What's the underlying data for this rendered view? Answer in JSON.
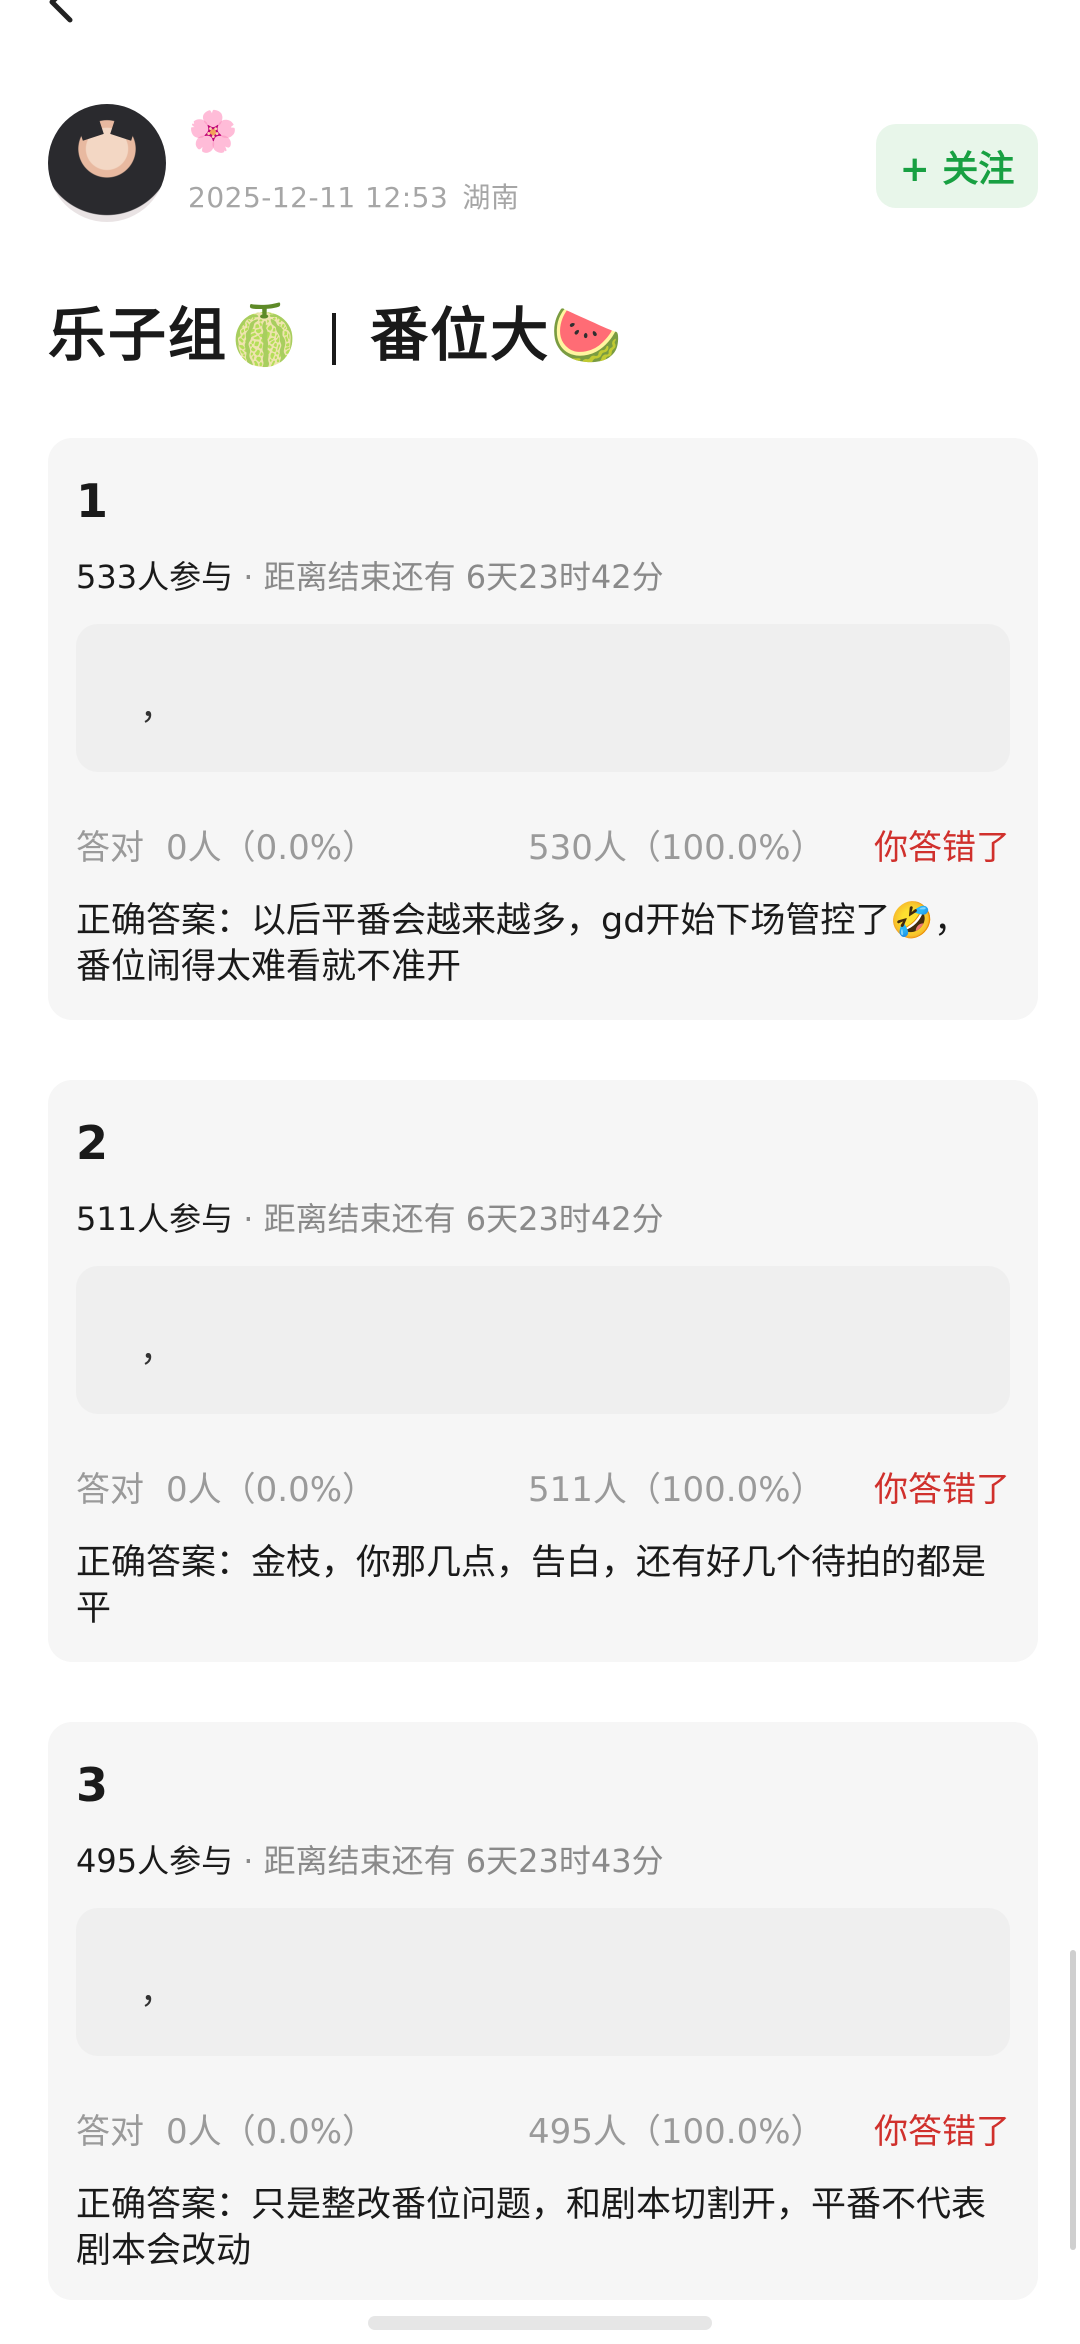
{
  "nav": {
    "back_icon": "chevron-left-icon"
  },
  "author": {
    "name_emoji": "🌸",
    "time": "2025-12-11 12:53",
    "location": "湖南"
  },
  "follow_button": {
    "label": "+ 关注"
  },
  "post": {
    "title_part1": "乐子组",
    "title_emoji1": "🍈",
    "title_part2": "番位大",
    "title_emoji2": "🍉"
  },
  "quizzes": [
    {
      "number": "1",
      "participants": "533人参与",
      "ends": " · 距离结束还有 6天23时42分",
      "answer_text": "，",
      "correct_label": "答对",
      "correct_count": "0人（0.0%）",
      "wrong_count": "530人（100.0%）",
      "status": "你答错了",
      "correct_answer": "正确答案：以后平番会越来越多，gd开始下场管控了🤣，番位闹得太难看就不准开"
    },
    {
      "number": "2",
      "participants": "511人参与",
      "ends": " · 距离结束还有 6天23时42分",
      "answer_text": "，",
      "correct_label": "答对",
      "correct_count": "0人（0.0%）",
      "wrong_count": "511人（100.0%）",
      "status": "你答错了",
      "correct_answer": "正确答案：金枝，你那几点，告白，还有好几个待拍的都是平"
    },
    {
      "number": "3",
      "participants": "495人参与",
      "ends": " · 距离结束还有 6天23时43分",
      "answer_text": "，",
      "correct_label": "答对",
      "correct_count": "0人（0.0%）",
      "wrong_count": "495人（100.0%）",
      "status": "你答错了",
      "correct_answer": "正确答案：只是整改番位问题，和剧本切割开，平番不代表剧本会改动"
    }
  ],
  "colors": {
    "follow_bg": "#e8f6ea",
    "follow_text": "#18a042",
    "wrong_text": "#d0302c",
    "card_bg": "#f6f6f6"
  }
}
